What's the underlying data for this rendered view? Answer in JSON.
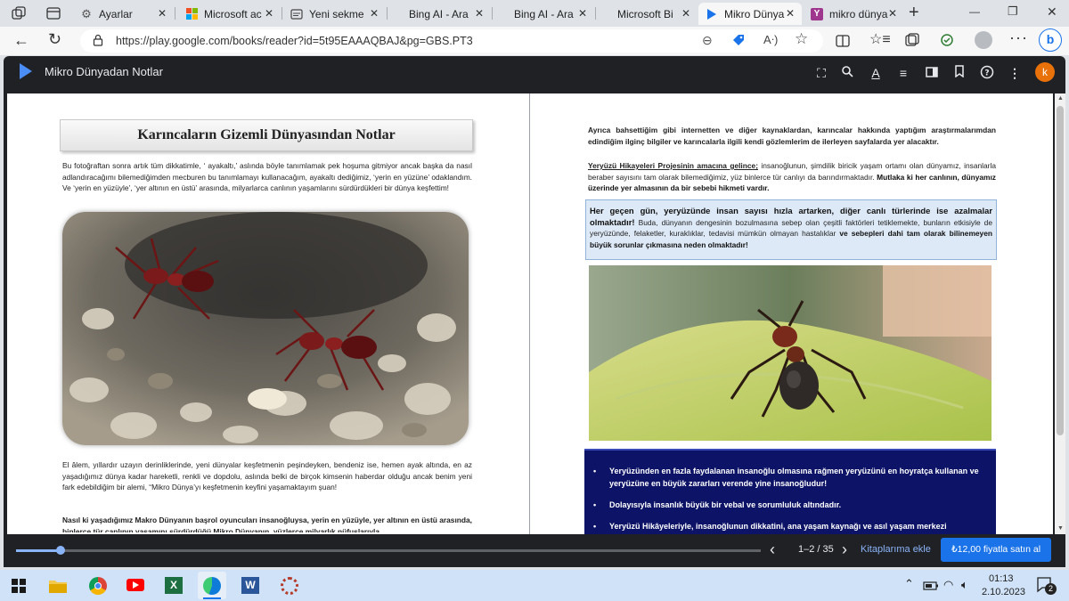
{
  "browser": {
    "tabs": [
      {
        "label": "",
        "active": false
      },
      {
        "label": "",
        "active": false
      },
      {
        "label": "Ayarlar",
        "active": false
      },
      {
        "label": "Microsoft ac",
        "active": false
      },
      {
        "label": "Yeni sekme",
        "active": false
      },
      {
        "label": "Bing AI - Ara",
        "active": false
      },
      {
        "label": "Bing AI - Ara",
        "active": false
      },
      {
        "label": "Microsoft Bi",
        "active": false
      },
      {
        "label": "Mikro Dünya",
        "active": true
      },
      {
        "label": "mikro dünya",
        "active": false
      }
    ],
    "url": "https://play.google.com/books/reader?id=5t95EAAAQBAJ&pg=GBS.PT3",
    "new_tab": "+",
    "window_min": "—",
    "window_max": "❐",
    "window_close": "✕"
  },
  "reader": {
    "title": "Mikro Dünyadan Notlar",
    "avatar_letter": "k",
    "page_indicator": "1–2 / 35",
    "add_to_library": "Kitaplarıma ekle",
    "buy_button": "₺12,00 fiyatla satın al",
    "progress": 0.06
  },
  "left_page": {
    "heading": "Karıncaların Gizemli Dünyasından Notlar",
    "para1": "Bu fotoğraftan sonra artık tüm dikkatimle, ‘ ayakaltı,’ aslında böyle tanımlamak pek hoşuma gitmiyor ancak başka da nasıl adlandıracağımı bilemediğimden mecburen bu tanımlamayı kullanacağım, ayakaltı dediğimiz, ‘yerin en yüzüne’ odaklandım. Ve ‘yerin en yüzüyle’, ‘yer altının en üstü’ arasında, milyarlarca canlının yaşamlarını sürdürdükleri bir dünya keşfettim!",
    "para2": "El âlem, yıllardır uzayın derinliklerinde, yeni dünyalar keşfetmenin peşindeyken, bendeniz ise, hemen ayak altında, en az yaşadığımız dünya kadar hareketli, renkli ve dopdolu, aslında belki de birçok kimsenin haberdar olduğu ancak benim yeni fark edebildiğim bir alemi, “Mikro Dünya’yı keşfetmenin keyfini yaşamaktayım şuan!",
    "para3": "Nasıl ki yaşadığımız Makro Dünyanın başrol oyuncuları insanoğluysa, yerin en yüzüyle, yer altının en üstü arasında, binlerce tür canlının yaşamını sürdürdüğü Mikro Dünyanın, yüzlerce milyarlık nüfuslarıyla"
  },
  "right_page": {
    "para1": "Ayrıca bahsettiğim gibi internetten ve diğer kaynaklardan, karıncalar hakkında yaptığım araştırmalarımdan edindiğim ilginç bilgiler ve karıncalarla ilgili kendi gözlemlerim de ilerleyen sayfalarda yer alacaktır.",
    "para2_link": "Yeryüzü Hikayeleri Projesinin amacına gelince;",
    "para2": " insanoğlunun, şimdilik biricik yaşam ortamı olan dünyamız, insanlarla beraber sayısını tam olarak bilemediğimiz, yüz binlerce tür canlıyı da barındırmaktadır. ",
    "para2_bold": "Mutlaka ki her canlının, dünyamız üzerinde yer almasının da bir sebebi hikmeti vardır.",
    "box_bold": "Her geçen gün, yeryüzünde insan sayısı hızla artarken, diğer canlı türlerinde ise azalmalar olmaktadır!",
    "box_text": " Buda, dünyanın dengesinin bozulmasına sebep olan çeşitli faktörleri tetiklemekte, bunların etkisiyle de yeryüzünde, felaketler, kuraklıklar, tedavisi mümkün olmayan hastalıklar ",
    "box_bold2": "ve sebepleri dahi tam olarak bilinemeyen büyük sorunlar çıkmasına neden olmaktadır!",
    "bullets": [
      "Yeryüzünden en fazla faydalanan insanoğlu olmasına rağmen yeryüzünü en hoyratça kullanan ve yeryüzüne en büyük zararları verende yine insanoğludur!",
      "Dolayısıyla insanlık büyük bir vebal ve sorumluluk altındadır.",
      "Yeryüzü Hikâyeleriyle, insanoğlunun dikkatini, ana yaşam kaynağı ve asıl yaşam merkezi"
    ]
  },
  "taskbar": {
    "time": "01:13",
    "date": "2.10.2023",
    "notification_count": "2"
  }
}
